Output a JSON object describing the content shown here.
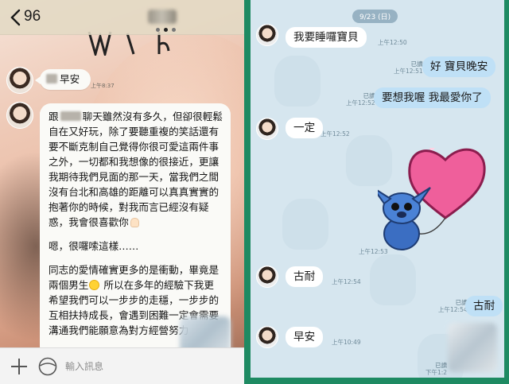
{
  "left_chat": {
    "header": {
      "back_count": "96",
      "contact_name": ""
    },
    "messages": [
      {
        "text": "早安",
        "time": "上午8:37"
      },
      {
        "paragraphs": [
          {
            "lead": "跟",
            "rest": "聊天雖然沒有多久，但卻很輕鬆自在又好玩，除了要聽重複的笑話還有要不斷克制自己覺得你很可愛這兩件事之外，一切都和我想像的很接近，更讓我期待我們見面的那一天，當我們之間沒有台北和高雄的距離可以真真實實的抱著你的時候，對我而言已經沒有疑惑，我會很喜歡你"
          },
          {
            "text": "嗯，很囉嗦這樣……"
          },
          {
            "before": "同志的愛情確實更多的是衝動，畢竟是兩個男生",
            "after": " 所以在多年的經驗下我更希望我們可以一步步的走穩，一步步的互相扶持成長，",
            "tail": "會遇到困難一定會需要溝通",
            "last": "我們能願意為對方經營努力"
          }
        ]
      }
    ],
    "input": {
      "placeholder": "輸入訊息",
      "value": ""
    }
  },
  "right_chat": {
    "top_icons": "",
    "date_label": "9/23 (日)",
    "messages": [
      {
        "side": "in",
        "text": "我要睡囉寶貝",
        "time": "上午12:50"
      },
      {
        "side": "out",
        "text": "好 寶貝晚安",
        "read": "已讀",
        "time": "上午12:51"
      },
      {
        "side": "out",
        "text": "要想我喔 我最愛你了",
        "read": "已讀",
        "time": "上午12:52"
      },
      {
        "side": "in",
        "text": "一定",
        "time": "上午12:52"
      },
      {
        "side": "in",
        "sticker": "stitch-heart-balloon-sticker",
        "time": "上午12:53"
      },
      {
        "side": "in",
        "text": "古耐",
        "time": "上午12:54"
      },
      {
        "side": "out",
        "text": "古耐",
        "read": "已讀",
        "time": "上午12:54"
      },
      {
        "side": "in",
        "text": "早安",
        "time": "上午10:49"
      },
      {
        "side": "out",
        "text": "",
        "read": "已讀",
        "time": "下午1:2"
      }
    ],
    "colors": {
      "frame": "#1e8a62",
      "background": "#d6e6ef",
      "outgoing_bubble": "#bfe0f6",
      "incoming_bubble": "#ffffff",
      "date_pill": "#97b2c3"
    }
  }
}
